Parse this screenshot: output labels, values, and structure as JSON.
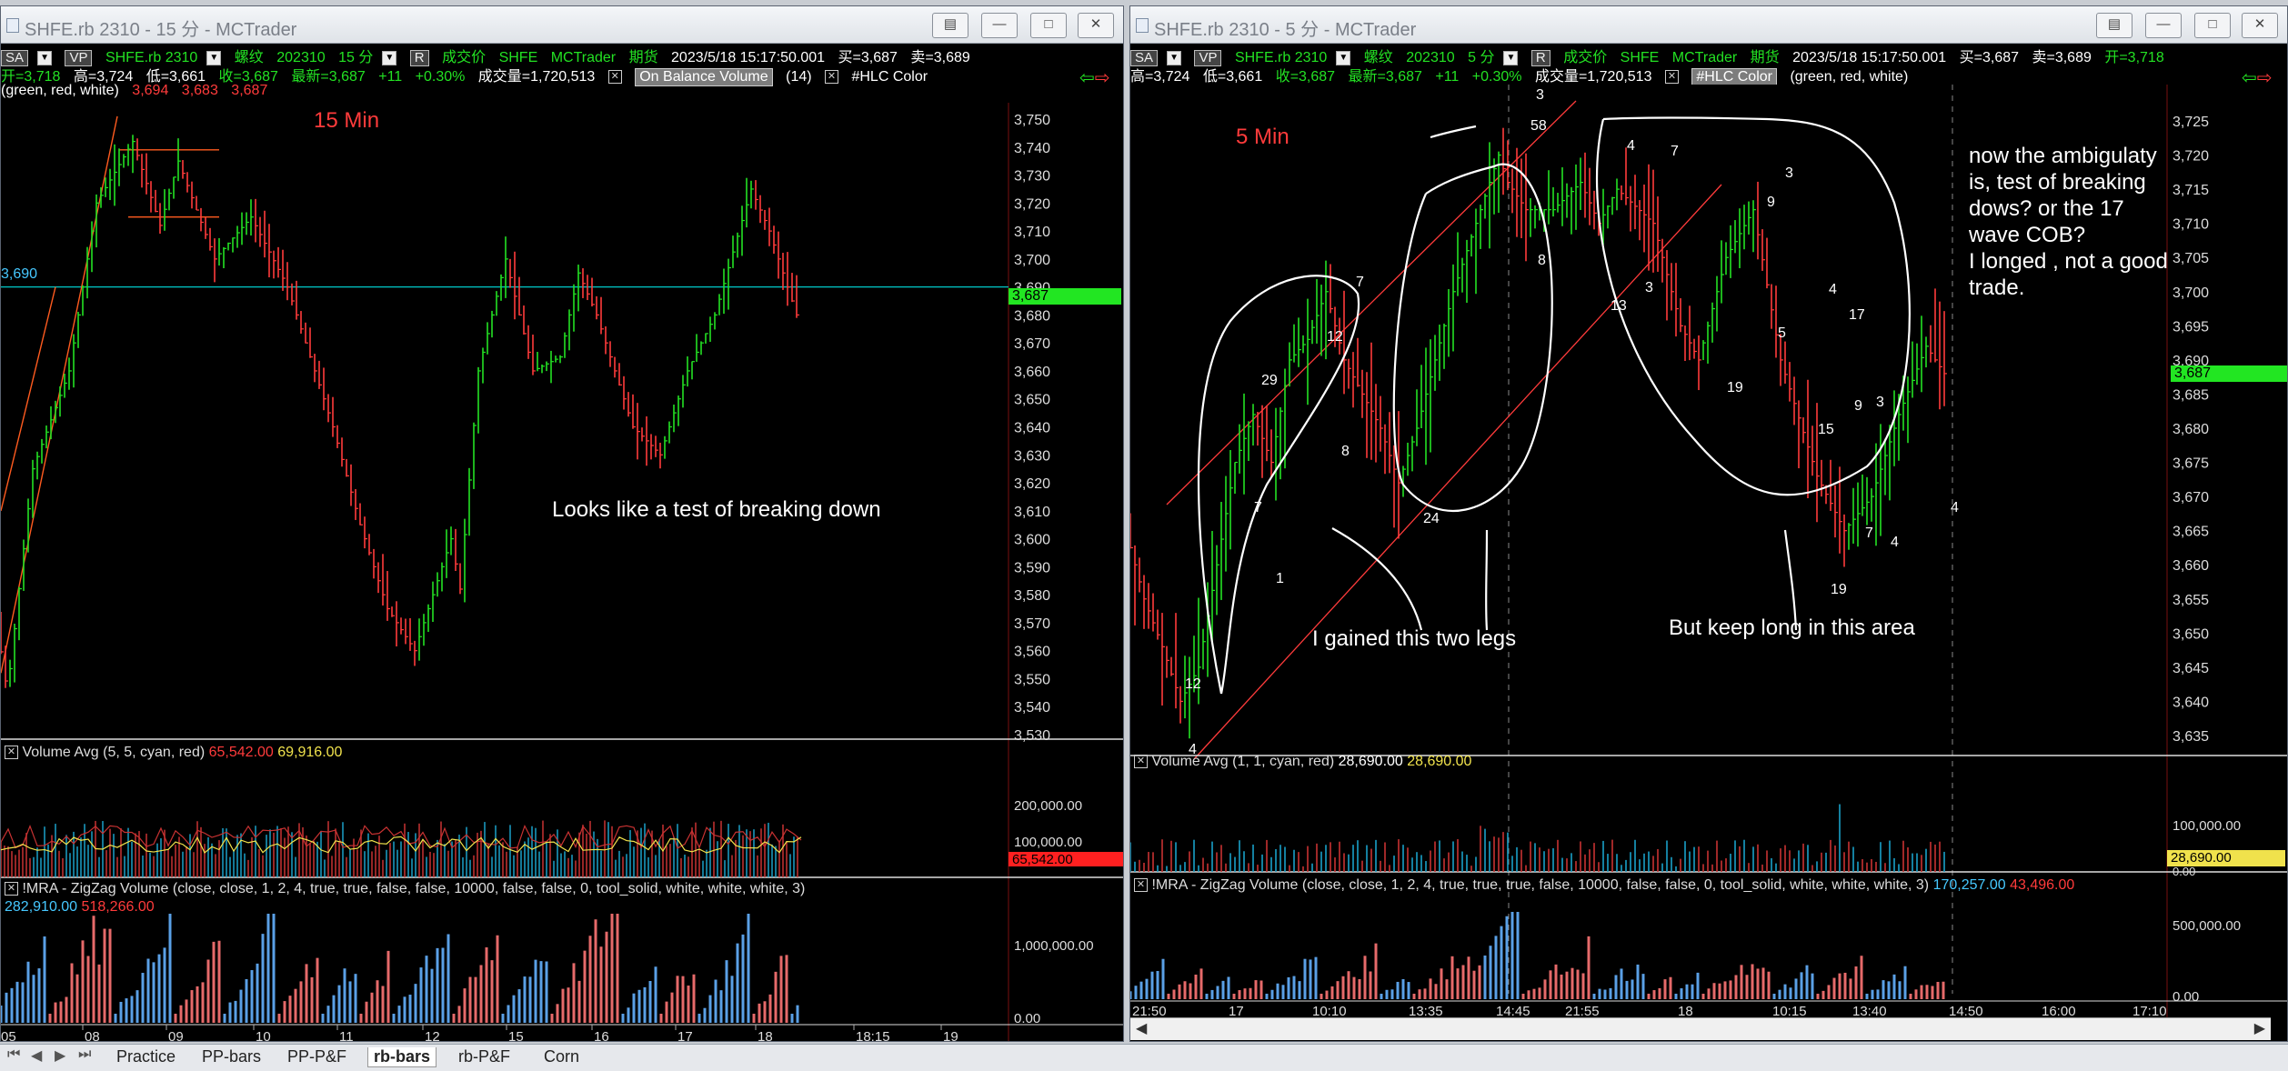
{
  "left": {
    "title": "SHFE.rb 2310 - 15 分 - MCTrader",
    "info1": {
      "sa": "SA",
      "vp": "VP",
      "symbol": "SHFE.rb 2310",
      "name": "螺纹",
      "contract": "202310",
      "tf": "15 分",
      "r": "R",
      "type": "成交价",
      "exch": "SHFE",
      "feed": "MCTrader",
      "cat": "期货",
      "datetime": "2023/5/18  15:17:50.001",
      "buy": "买=3,687",
      "sell": "卖=3,689"
    },
    "info2": {
      "open": "开=3,718",
      "high": "高=3,724",
      "low": "低=3,661",
      "close": "收=3,687",
      "last": "最新=3,687",
      "chg": "+11",
      "pct": "+0.30%",
      "vol": "成交量=1,720,513",
      "obv": "On Balance Volume",
      "obv_len": "(14)",
      "hlc": "#HLC Color"
    },
    "info3": {
      "params": "(green, red, white)",
      "v1": "3,694",
      "v2": "3,683",
      "v3": "3,687"
    },
    "label": "15 Min",
    "note": "Looks like a test of breaking down",
    "hline_label": "3,690",
    "price_tag": "3,687",
    "price_axis": [
      "3,750",
      "3,740",
      "3,730",
      "3,720",
      "3,710",
      "3,700",
      "3,690",
      "3,680",
      "3,670",
      "3,660",
      "3,650",
      "3,640",
      "3,630",
      "3,620",
      "3,610",
      "3,600",
      "3,590",
      "3,580",
      "3,570",
      "3,560",
      "3,550",
      "3,540",
      "3,530"
    ],
    "volume_title": "Volume Avg",
    "volume_params": "(5,  5,  cyan,  red)",
    "volume_v1": "65,542.00",
    "volume_v2": "69,916.00",
    "volume_axis": [
      "200,000.00",
      "100,000.00"
    ],
    "volume_tag": "65,542.00",
    "zz_title": "!MRA - ZigZag Volume",
    "zz_params": "(close,  close,  1,  2,  4,  true,  true,  false,  false,  10000,  false,  false,  0,  tool_solid,  white,  white,  white,  3)",
    "zz_v1": "282,910.00",
    "zz_v2": "518,266.00",
    "zz_axis": [
      "1,000,000.00",
      "0.00"
    ],
    "time_axis": [
      "05",
      "08",
      "09",
      "10",
      "11",
      "12",
      "15",
      "16",
      "17",
      "18",
      "18:15",
      "19"
    ]
  },
  "right": {
    "title": "SHFE.rb 2310 - 5 分 - MCTrader",
    "info1": {
      "sa": "SA",
      "vp": "VP",
      "symbol": "SHFE.rb 2310",
      "name": "螺纹",
      "contract": "202310",
      "tf": "5 分",
      "r": "R",
      "type": "成交价",
      "exch": "SHFE",
      "feed": "MCTrader",
      "cat": "期货",
      "datetime": "2023/5/18  15:17:50.001",
      "buy": "买=3,687",
      "sell": "卖=3,689",
      "open": "开=3,718"
    },
    "info2": {
      "high": "高=3,724",
      "low": "低=3,661",
      "close": "收=3,687",
      "last": "最新=3,687",
      "chg": "+11",
      "pct": "+0.30%",
      "vol": "成交量=1,720,513",
      "hlc": "#HLC Color",
      "params": "(green,  red,  white)"
    },
    "label": "5 Min",
    "note_legs": "I gained this two legs",
    "note_long": "But keep long in this area",
    "note_amb": [
      "now the ambigulaty",
      "is, test of breaking",
      "dows? or the 17",
      "wave COB?",
      "I longed , not a good",
      "trade."
    ],
    "price_tag": "3,687",
    "price_axis": [
      "3,725",
      "3,720",
      "3,715",
      "3,710",
      "3,705",
      "3,700",
      "3,695",
      "3,690",
      "3,685",
      "3,680",
      "3,675",
      "3,670",
      "3,665",
      "3,660",
      "3,655",
      "3,650",
      "3,645",
      "3,640",
      "3,635"
    ],
    "wave_counts": [
      "3",
      "58",
      "8",
      "4",
      "7",
      "3",
      "9",
      "13",
      "3",
      "4",
      "5",
      "19",
      "17",
      "29",
      "12",
      "7",
      "8",
      "7",
      "24",
      "1",
      "12",
      "4",
      "15",
      "9",
      "3",
      "7",
      "4",
      "19",
      "4"
    ],
    "volume_title": "Volume Avg",
    "volume_params": "(1,  1,  cyan,  red)",
    "volume_v1": "28,690.00",
    "volume_v2": "28,690.00",
    "volume_axis": [
      "100,000.00",
      "0.00"
    ],
    "volume_tag": "28,690.00",
    "zz_title": "!MRA - ZigZag Volume",
    "zz_params": "(close,  close,  1,  2,  4,  true,  true,  true,  false,  10000,  false,  false,  0,  tool_solid,  white,  white,  white,  3)",
    "zz_v1": "170,257.00",
    "zz_v2": "43,496.00",
    "zz_axis": [
      "500,000.00",
      "0.00"
    ],
    "time_axis": [
      "21:50",
      "17",
      "10:10",
      "13:35",
      "14:45",
      "21:55",
      "18",
      "10:15",
      "13:40",
      "14:50",
      "16:00",
      "17:10"
    ]
  },
  "tabs": [
    "Practice",
    "PP-bars",
    "PP-P&F",
    "rb-bars",
    "rb-P&F",
    "Corn"
  ],
  "active_tab": "rb-bars",
  "colors": {
    "up": "#23e123",
    "down": "#ff3b3b",
    "cyan": "#46c8ff",
    "yellow": "#f0e24c",
    "tag": "#22e622"
  }
}
